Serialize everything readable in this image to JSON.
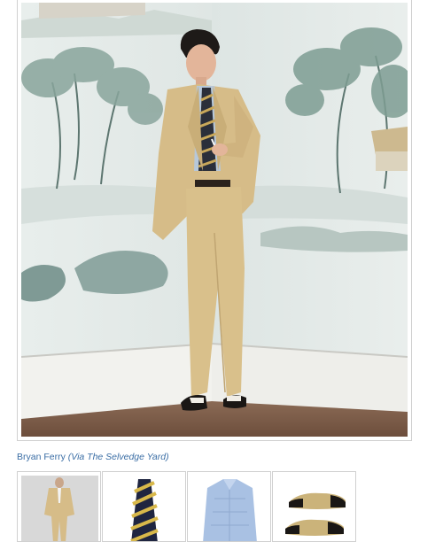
{
  "caption": {
    "name": "Bryan Ferry",
    "source": "(Via The Selvedge Yard)"
  },
  "thumbnails": [
    {
      "icon": "suit-icon"
    },
    {
      "icon": "striped-tie-icon"
    },
    {
      "icon": "blue-shirt-icon"
    },
    {
      "icon": "wingtip-shoes-icon"
    }
  ],
  "colors": {
    "caption_link": "#3b6ea5",
    "suit": "#d9c08b",
    "wall": "#e4eae8",
    "floor": "#7a5a45"
  }
}
